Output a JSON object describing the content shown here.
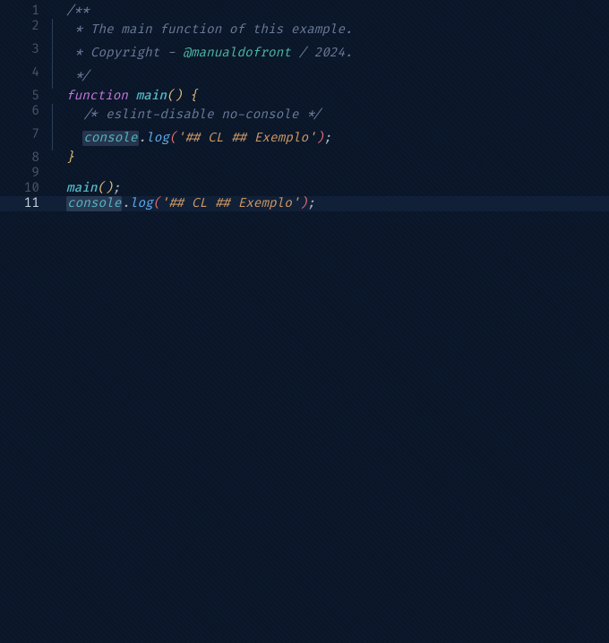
{
  "editor": {
    "active_line": 11,
    "lines": [
      {
        "num": 1
      },
      {
        "num": 2
      },
      {
        "num": 3
      },
      {
        "num": 4
      },
      {
        "num": 5
      },
      {
        "num": 6
      },
      {
        "num": 7
      },
      {
        "num": 8
      },
      {
        "num": 9
      },
      {
        "num": 10
      },
      {
        "num": 11
      }
    ],
    "tokens": {
      "l1_comment": "/**",
      "l2_comment": " * The main function of this example.",
      "l3_prefix": " * Copyright - ",
      "l3_tag": "@manualdofront",
      "l3_suffix": " / 2024.",
      "l4_comment": " */",
      "l5_keyword": "function",
      "l5_name": "main",
      "l5_paren_open": "(",
      "l5_paren_close": ")",
      "l5_brace": " {",
      "l6_comment": "/* eslint-disable no-console */",
      "l7_obj": "console",
      "l7_dot": ".",
      "l7_method": "log",
      "l7_paren_open": "(",
      "l7_string": "'## CL ## Exemplo'",
      "l7_paren_close": ")",
      "l7_semi": ";",
      "l8_brace": "}",
      "l10_name": "main",
      "l10_paren_open": "(",
      "l10_paren_close": ")",
      "l10_semi": ";",
      "l11_obj": "console",
      "l11_dot": ".",
      "l11_method": "log",
      "l11_paren_open": "(",
      "l11_string": "'## CL ## Exemplo'",
      "l11_paren_close": ")",
      "l11_semi": ";"
    }
  }
}
